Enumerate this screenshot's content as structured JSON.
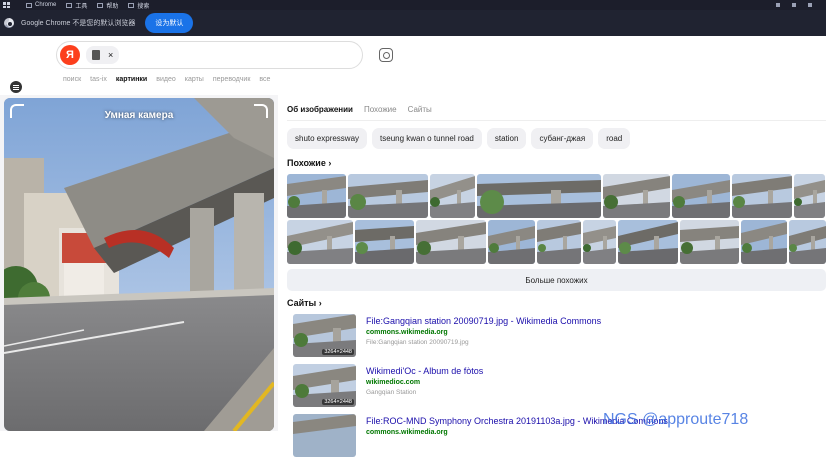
{
  "os_bar": {
    "items": [
      "Chrome",
      "工具",
      "帮助",
      "搜索"
    ]
  },
  "banner": {
    "message": "Google Chrome 不是您的默认浏览器",
    "button": "设为默认"
  },
  "search": {
    "logo": "Я",
    "chip_close": "×"
  },
  "nav_tabs": [
    {
      "label": "поиск",
      "active": false
    },
    {
      "label": "tas-ix",
      "active": false
    },
    {
      "label": "картинки",
      "active": true
    },
    {
      "label": "видео",
      "active": false
    },
    {
      "label": "карты",
      "active": false
    },
    {
      "label": "переводчик",
      "active": false
    },
    {
      "label": "все",
      "active": false
    }
  ],
  "left_panel": {
    "title": "Умная камера"
  },
  "right_tabs": [
    {
      "label": "Об изображении",
      "active": true
    },
    {
      "label": "Похожие",
      "active": false
    },
    {
      "label": "Сайты",
      "active": false
    }
  ],
  "tags": [
    "shuto expressway",
    "tseung kwan o tunnel road",
    "station",
    "субанг-джая",
    "road"
  ],
  "similar": {
    "title": "Похожие ›",
    "more_button": "Больше похожих",
    "row1_count": 9,
    "row2_count": 10
  },
  "sites": {
    "title": "Сайты ›",
    "items": [
      {
        "title": "File:Gangqian station 20090719.jpg - Wikimedia Commons",
        "domain": "commons.wikimedia.org",
        "sub": "File:Gangqian station 20090719.jpg",
        "res": "3264×2448"
      },
      {
        "title": "Wikimedi'Oc - Album de fòtos",
        "domain": "wikimedioc.com",
        "sub": "Gangqian Station",
        "res": "3264×2448"
      },
      {
        "title": "File:ROC-MND Symphony Orchestra 20191103a.jpg - Wikimedia Commons",
        "domain": "commons.wikimedia.org",
        "sub": "",
        "res": ""
      }
    ]
  },
  "watermark": "NGS @approute718",
  "colors": {
    "yandex_red": "#fc3f1d",
    "link_blue": "#1a0dab",
    "domain_green": "#007700",
    "chrome_blue": "#1a73e8"
  }
}
